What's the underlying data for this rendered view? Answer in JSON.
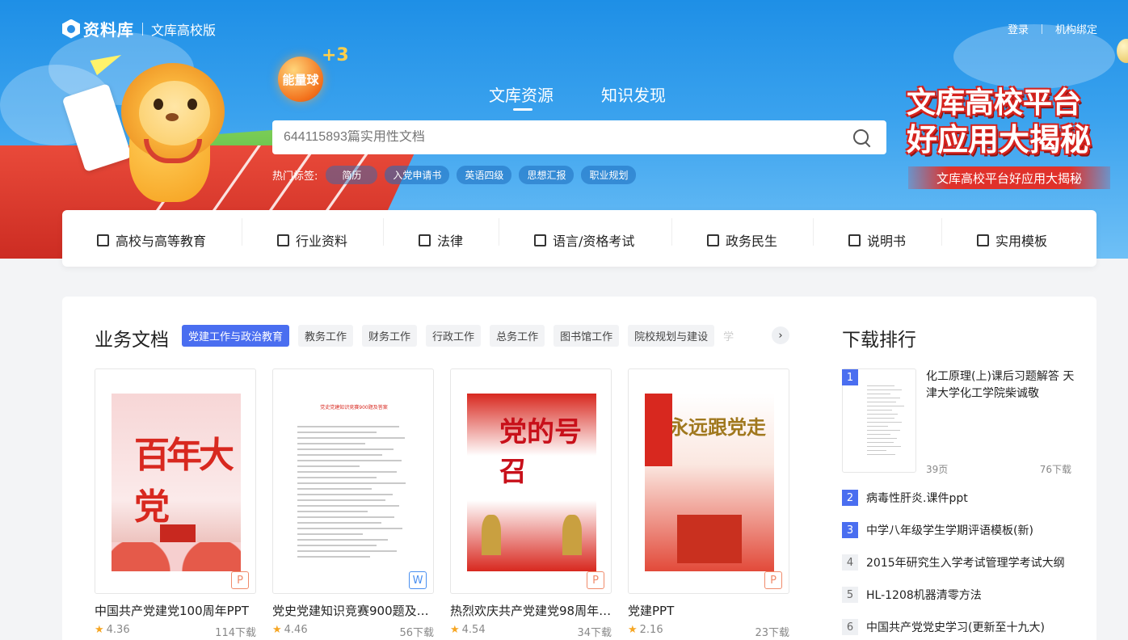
{
  "header": {
    "logo_name": "资料库",
    "logo_sub": "文库高校版",
    "login": "登录",
    "bind_org": "机构绑定"
  },
  "hero": {
    "energy_label": "能量球",
    "energy_plus": "+3",
    "tabs": [
      {
        "label": "文库资源",
        "active": true
      },
      {
        "label": "知识发现",
        "active": false
      }
    ],
    "search_placeholder": "644115893篇实用性文档",
    "hot_label": "热门标签:",
    "hot_tags": [
      "简历",
      "入党申请书",
      "英语四级",
      "思想汇报",
      "职业规划"
    ],
    "promo_line1": "文库高校平台",
    "promo_line2": "好应用大揭秘",
    "promo_bar": "文库高校平台好应用大揭秘"
  },
  "categories": [
    {
      "label": "高校与高等教育",
      "icon": "university-icon"
    },
    {
      "label": "行业资料",
      "icon": "book-icon"
    },
    {
      "label": "法律",
      "icon": "gavel-icon"
    },
    {
      "label": "语言/资格考试",
      "icon": "save-icon"
    },
    {
      "label": "政务民生",
      "icon": "building-icon"
    },
    {
      "label": "说明书",
      "icon": "message-icon"
    },
    {
      "label": "实用模板",
      "icon": "template-icon"
    }
  ],
  "business": {
    "title": "业务文档",
    "tags": [
      "党建工作与政治教育",
      "教务工作",
      "财务工作",
      "行政工作",
      "总务工作",
      "图书馆工作",
      "院校规划与建设"
    ],
    "tag_fade": "学",
    "docs": [
      {
        "title": "中国共产党建党100周年PPT",
        "rating": "4.36",
        "downloads": "114下载",
        "type": "P",
        "thumb_text": "百年大党"
      },
      {
        "title": "党史党建知识竞赛900题及答案",
        "rating": "4.46",
        "downloads": "56下载",
        "type": "W",
        "thumb_text": "党史党建知识竞赛900题及答案"
      },
      {
        "title": "热烈欢庆共产党建党98周年PPT",
        "rating": "4.54",
        "downloads": "34下载",
        "type": "P",
        "thumb_text": "党的号召"
      },
      {
        "title": "党建PPT",
        "rating": "2.16",
        "downloads": "23下载",
        "type": "P",
        "thumb_text": "永远跟党走"
      }
    ]
  },
  "ranking": {
    "title": "下载排行",
    "first": {
      "num": "1",
      "title": "化工原理(上)课后习题解答 天津大学化工学院柴诚敬",
      "pages": "39页",
      "downloads": "76下载"
    },
    "items": [
      {
        "num": "2",
        "title": "病毒性肝炎.课件ppt",
        "highlight": true
      },
      {
        "num": "3",
        "title": "中学八年级学生学期评语模板(新)",
        "highlight": true
      },
      {
        "num": "4",
        "title": "2015年研究生入学考试管理学考试大纲",
        "highlight": false
      },
      {
        "num": "5",
        "title": "HL-1208机器清零方法",
        "highlight": false
      },
      {
        "num": "6",
        "title": "中国共产党党史学习(更新至十九大)",
        "highlight": false
      }
    ]
  },
  "colors": {
    "accent": "#4a6ef0",
    "hero_blue": "#2b8fe4",
    "promo_red": "#e0312a"
  }
}
